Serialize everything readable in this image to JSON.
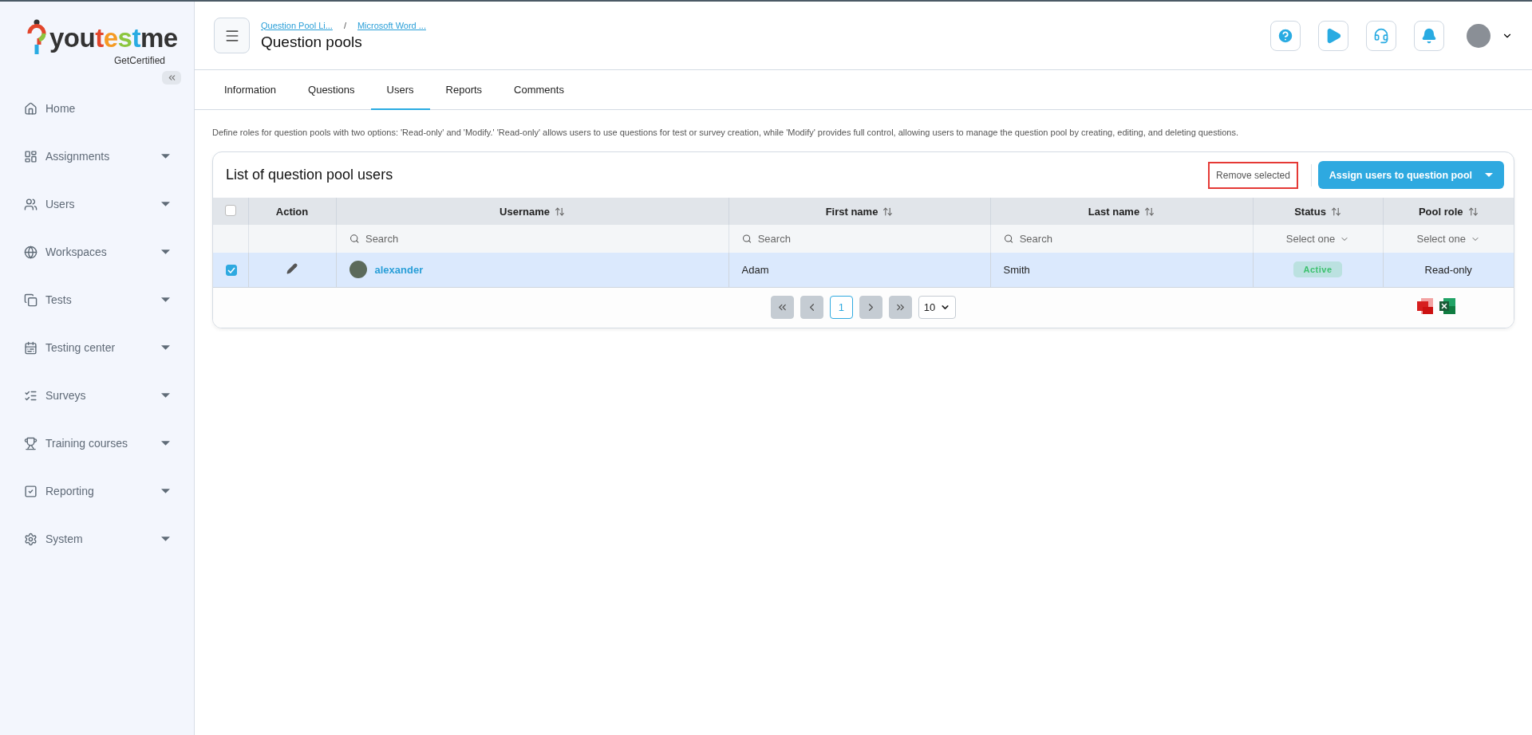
{
  "logo": {
    "parts": [
      {
        "text": "you",
        "color": "#333333"
      },
      {
        "text": "t",
        "color": "#e2462c"
      },
      {
        "text": "e",
        "color": "#f59a23"
      },
      {
        "text": "s",
        "color": "#8cc63f"
      },
      {
        "text": "t",
        "color": "#29abe2"
      },
      {
        "text": "me",
        "color": "#333333"
      }
    ],
    "tagline": "GetCertified"
  },
  "sidebar": {
    "items": [
      {
        "label": "Home",
        "kind": "link"
      },
      {
        "label": "Assignments",
        "kind": "group"
      },
      {
        "label": "Users",
        "kind": "group"
      },
      {
        "label": "Workspaces",
        "kind": "group"
      },
      {
        "label": "Tests",
        "kind": "group"
      },
      {
        "label": "Testing center",
        "kind": "group"
      },
      {
        "label": "Surveys",
        "kind": "group"
      },
      {
        "label": "Training courses",
        "kind": "group"
      },
      {
        "label": "Reporting",
        "kind": "group"
      },
      {
        "label": "System",
        "kind": "group"
      }
    ]
  },
  "header": {
    "breadcrumbs": [
      "Question Pool Li...",
      "Microsoft Word ..."
    ],
    "separator": "/",
    "title": "Question pools"
  },
  "tabs": [
    {
      "label": "Information",
      "selected": false
    },
    {
      "label": "Questions",
      "selected": false
    },
    {
      "label": "Users",
      "selected": true
    },
    {
      "label": "Reports",
      "selected": false
    },
    {
      "label": "Comments",
      "selected": false
    }
  ],
  "description": "Define roles for question pools with two options: 'Read-only' and 'Modify.' 'Read-only' allows users to use questions for test or survey creation, while 'Modify' provides full control, allowing users to manage the question pool by creating, editing, and deleting questions.",
  "card": {
    "title": "List of question pool users",
    "remove_button": {
      "label": "Remove selected",
      "highlighted": true
    },
    "assign_button": "Assign users to question pool"
  },
  "table": {
    "select_all": {
      "checked": false
    },
    "columns": [
      {
        "label": "Action",
        "sortable": false,
        "filter": {
          "kind": "none"
        }
      },
      {
        "label": "Username",
        "sortable": true,
        "filter": {
          "kind": "search",
          "placeholder": "Search"
        }
      },
      {
        "label": "First name",
        "sortable": true,
        "filter": {
          "kind": "search",
          "placeholder": "Search"
        }
      },
      {
        "label": "Last name",
        "sortable": true,
        "filter": {
          "kind": "search",
          "placeholder": "Search"
        }
      },
      {
        "label": "Status",
        "sortable": true,
        "filter": {
          "kind": "select",
          "placeholder": "Select one"
        }
      },
      {
        "label": "Pool role",
        "sortable": true,
        "filter": {
          "kind": "select",
          "placeholder": "Select one"
        }
      }
    ],
    "rows": [
      {
        "selected": true,
        "username": "alexander",
        "first_name": "Adam",
        "last_name": "Smith",
        "status": {
          "label": "Active",
          "color": "#3cc16e"
        },
        "pool_role": "Read-only"
      }
    ]
  },
  "pagination": {
    "pages": [
      {
        "label": "1",
        "selected": true
      }
    ],
    "page_size": "10"
  }
}
